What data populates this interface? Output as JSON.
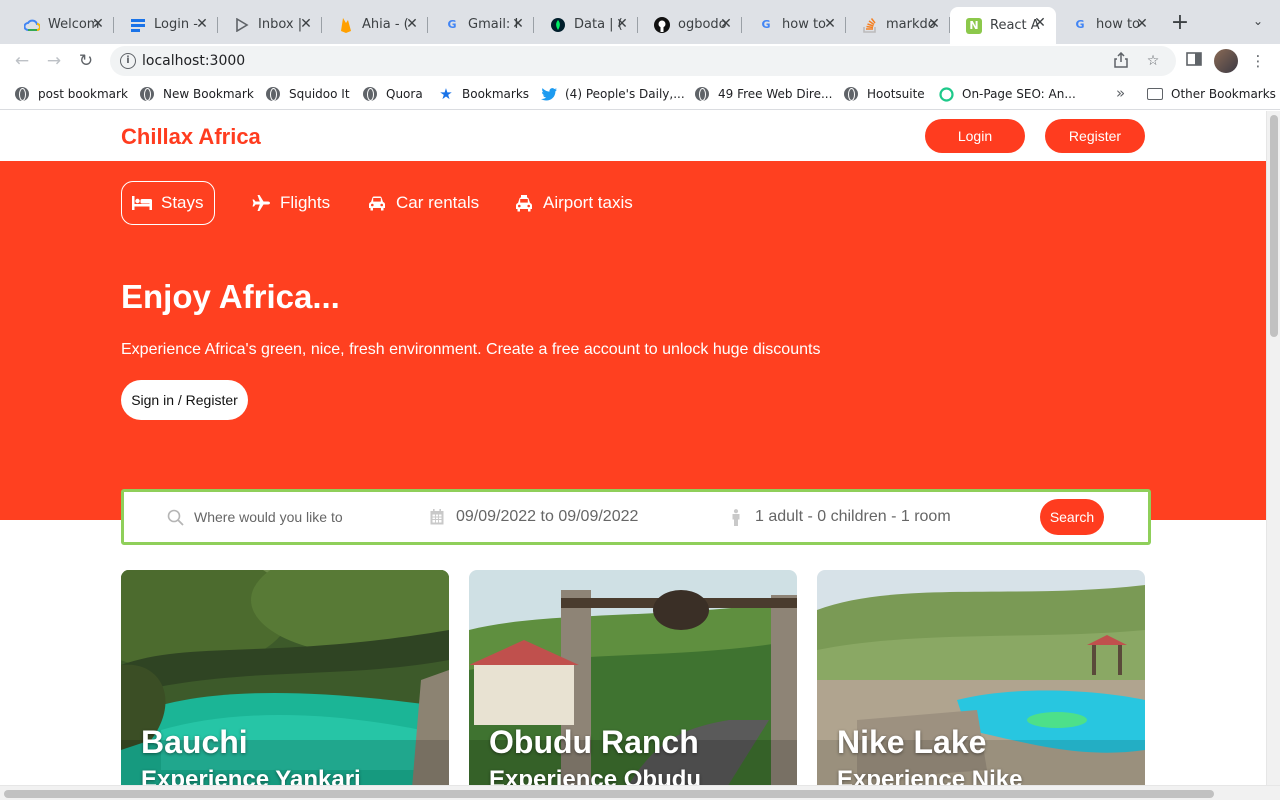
{
  "browser": {
    "tabs": [
      {
        "title": "Welcom",
        "favicon": "google-cloud-icon"
      },
      {
        "title": "Login -",
        "favicon": "list-icon"
      },
      {
        "title": "Inbox |",
        "favicon": "play-icon"
      },
      {
        "title": "Ahia - (",
        "favicon": "firebase-icon"
      },
      {
        "title": "Gmail: I",
        "favicon": "google-icon"
      },
      {
        "title": "Data | (",
        "favicon": "mongodb-leaf-icon"
      },
      {
        "title": "ogbodo",
        "favicon": "github-icon"
      },
      {
        "title": "how to",
        "favicon": "google-icon"
      },
      {
        "title": "markdo",
        "favicon": "stackoverflow-icon"
      },
      {
        "title": "React A",
        "favicon": "nodejs-icon",
        "active": true
      },
      {
        "title": "how to",
        "favicon": "google-icon"
      }
    ],
    "url": "localhost:3000",
    "bookmarks": [
      {
        "label": "post bookmark",
        "icon": "globe-icon"
      },
      {
        "label": "New Bookmark",
        "icon": "globe-icon"
      },
      {
        "label": "Squidoo It",
        "icon": "globe-icon"
      },
      {
        "label": "Quora",
        "icon": "globe-icon"
      },
      {
        "label": "Bookmarks",
        "icon": "star-icon"
      },
      {
        "label": "(4) People's Daily,...",
        "icon": "twitter-icon"
      },
      {
        "label": "49 Free Web Dire...",
        "icon": "globe-icon"
      },
      {
        "label": "Hootsuite",
        "icon": "globe-icon"
      },
      {
        "label": "On-Page SEO: An...",
        "icon": "circle-icon"
      }
    ],
    "bookmarks_overflow": "»",
    "other_bookmarks": "Other Bookmarks"
  },
  "site": {
    "brand": "Chillax Africa",
    "login_label": "Login",
    "register_label": "Register",
    "accent_color": "#ff3c1f",
    "nav": [
      {
        "label": "Stays",
        "icon": "bed-icon",
        "active": true
      },
      {
        "label": "Flights",
        "icon": "plane-icon"
      },
      {
        "label": "Car rentals",
        "icon": "car-icon"
      },
      {
        "label": "Airport taxis",
        "icon": "taxi-icon"
      }
    ],
    "hero": {
      "title": "Enjoy Africa...",
      "description": "Experience Africa's green, nice, fresh environment. Create a free account to unlock huge discounts",
      "cta": "Sign in / Register"
    },
    "search": {
      "destination_placeholder": "Where would you like to go?",
      "dates": "09/09/2022 to 09/09/2022",
      "guests": "1 adult - 0 children - 1 room",
      "button": "Search"
    },
    "featured": [
      {
        "title": "Bauchi",
        "subtitle": "Experience Yankari"
      },
      {
        "title": "Obudu Ranch",
        "subtitle": "Experience Obudu"
      },
      {
        "title": "Nike Lake",
        "subtitle": "Experience Nike"
      }
    ]
  }
}
